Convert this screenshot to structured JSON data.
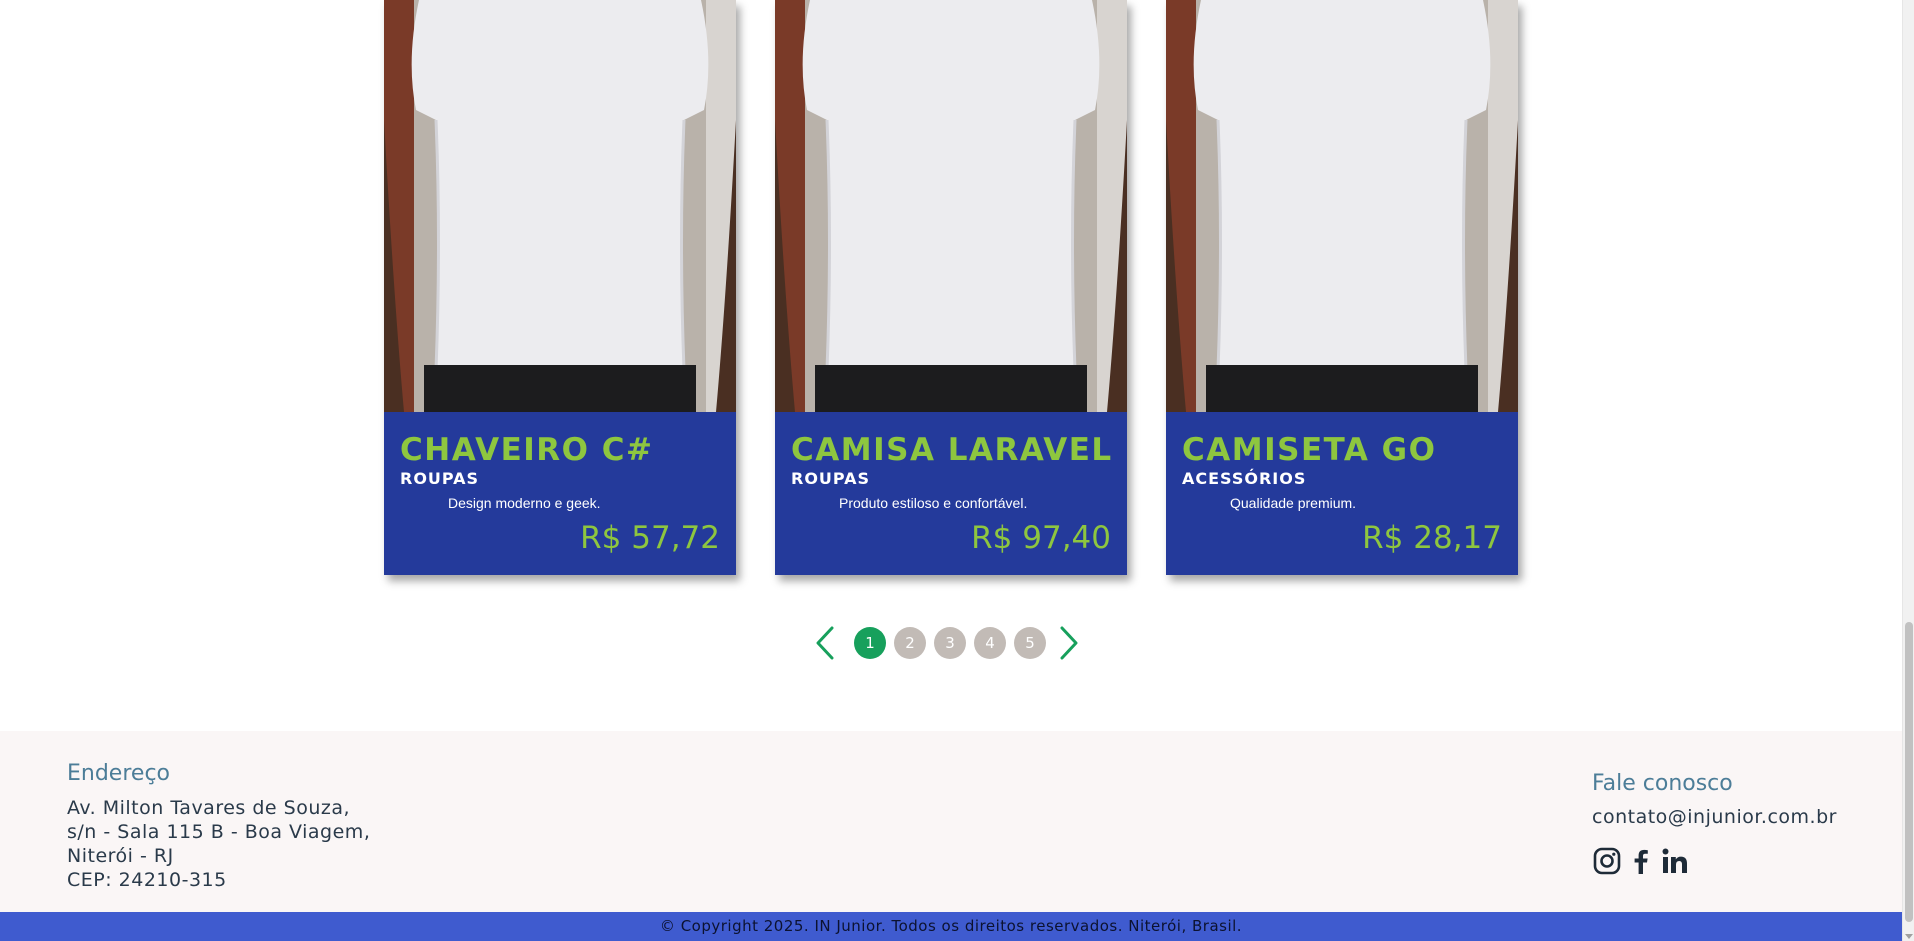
{
  "products": [
    {
      "title": "CHAVEIRO C#",
      "category": "ROUPAS",
      "description": "Design moderno e geek.",
      "price": "R$ 57,72",
      "image_icon": "white-tshirt-photo"
    },
    {
      "title": "CAMISA LARAVEL",
      "category": "ROUPAS",
      "description": "Produto estiloso e confortável.",
      "price": "R$ 97,40",
      "image_icon": "white-tshirt-photo"
    },
    {
      "title": "CAMISETA GO",
      "category": "ACESSÓRIOS",
      "description": "Qualidade premium.",
      "price": "R$ 28,17",
      "image_icon": "white-tshirt-photo"
    }
  ],
  "pagination": {
    "pages": [
      "1",
      "2",
      "3",
      "4",
      "5"
    ],
    "current": "1",
    "prev_icon": "chevron-left-icon",
    "next_icon": "chevron-right-icon"
  },
  "footer": {
    "address_title": "Endereço",
    "address_lines": [
      "Av. Milton Tavares de Souza,",
      "s/n - Sala 115 B - Boa Viagem,",
      "Niterói - RJ",
      "CEP: 24210-315"
    ],
    "contact_title": "Fale conosco",
    "contact_email": "contato@injunior.com.br",
    "social_icons": [
      "instagram-icon",
      "facebook-icon",
      "linkedin-icon"
    ]
  },
  "copyright": "© Copyright 2025. IN Junior. Todos os direitos reservados. Niterói, Brasil.",
  "colors": {
    "card_bg": "#243a9b",
    "accent_green": "#8ec63f",
    "pagination_active": "#17a05c",
    "pagination_inactive": "#c2bbb6",
    "footer_bg": "#faf6f6",
    "copyright_bg": "#3f5bcf"
  }
}
